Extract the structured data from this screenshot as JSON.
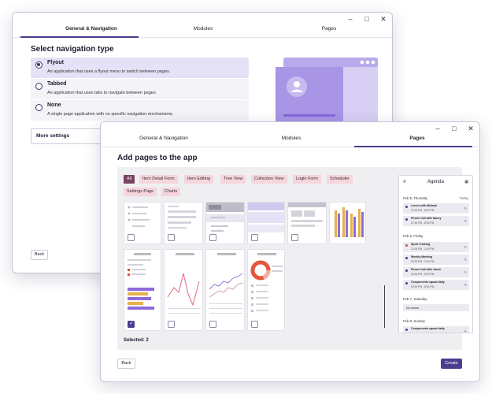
{
  "win1": {
    "tabs": [
      "General & Navigation",
      "Modules",
      "Pages"
    ],
    "title": "Select navigation type",
    "options": [
      {
        "title": "Flyout",
        "desc": "An application that uses a flyout menu to switch between pages.",
        "selected": true
      },
      {
        "title": "Tabbed",
        "desc": "An application that uses tabs to navigate between pages.",
        "selected": false
      },
      {
        "title": "None",
        "desc": "A single page application with no specific navigation mechanisms.",
        "selected": false
      }
    ],
    "more_settings": "More settings",
    "back": "Back"
  },
  "win2": {
    "tabs": [
      "General & Navigation",
      "Modules",
      "Pages"
    ],
    "title": "Add pages to the app",
    "chips": [
      "All",
      "Item Detail Form",
      "Item Editing",
      "Tree View",
      "Collection View",
      "Login Form",
      "Scheduler",
      "Settings Page",
      "Charts"
    ],
    "selected_text": "Selected: 2",
    "back": "Back",
    "create": "Create",
    "agenda": {
      "title": "Agenda",
      "today": "Today",
      "days": [
        {
          "date": "Feb 5, Thursday",
          "events": [
            {
              "title": "Lunch with Michael",
              "time": "07:00 PM - 8:00 PM"
            },
            {
              "title": "Phone Call with Nancy",
              "time": "07:30 PM - 8:30 PM"
            }
          ]
        },
        {
          "date": "Feb 6, Friday",
          "events": [
            {
              "title": "Sport Training",
              "time": "12:00 PM - 1:00 PM"
            },
            {
              "title": "Weekly Meeting",
              "time": "02:30 PM - 3:00 PM"
            },
            {
              "title": "Phone Call with Jason",
              "time": "03:30 PM - 5:00 PM"
            },
            {
              "title": "Components squad daily",
              "time": "03:30 PM - 5:00 PM"
            }
          ]
        },
        {
          "date": "Feb 7, Saturday",
          "events": [
            {
              "title": "No events",
              "time": ""
            }
          ]
        },
        {
          "date": "Feb 8, Sunday",
          "events": [
            {
              "title": "Components squad daily",
              "time": ""
            }
          ]
        }
      ]
    }
  },
  "colors": {
    "accent": "#4b3d8f",
    "chip": "#f6d5dd",
    "chip_active": "#7a4360",
    "selection": "#e5e1f6"
  }
}
